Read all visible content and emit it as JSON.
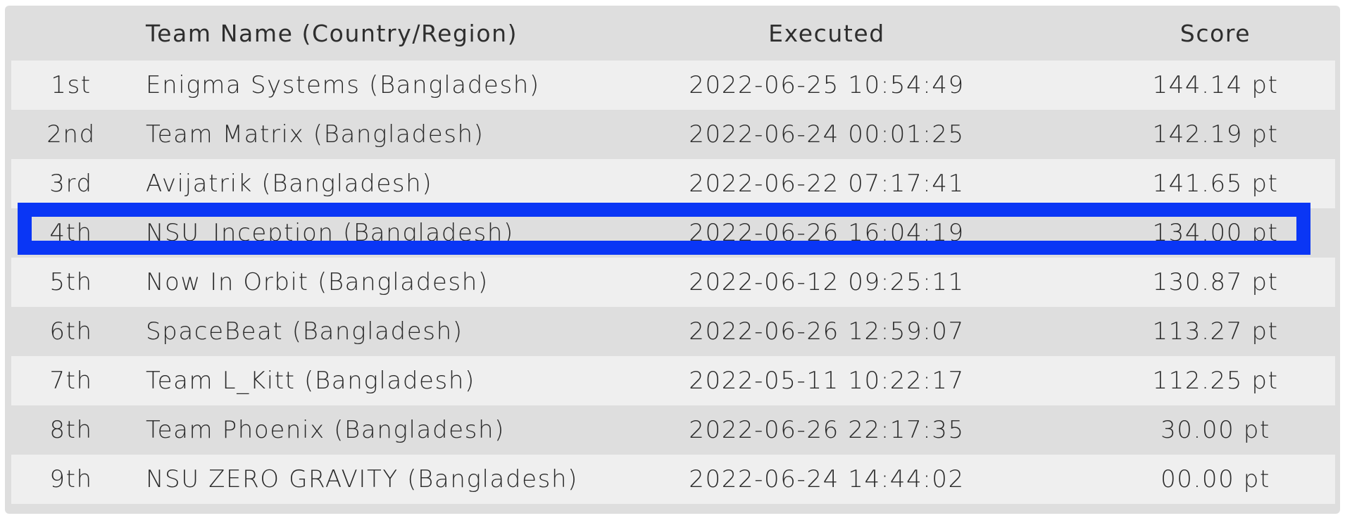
{
  "header": {
    "rank": "",
    "team": "Team Name (Country/Region)",
    "executed": "Executed",
    "score": "Score"
  },
  "rows": [
    {
      "rank": "1st",
      "team": "Enigma Systems (Bangladesh)",
      "executed": "2022-06-25 10:54:49",
      "score": "144.14 pt"
    },
    {
      "rank": "2nd",
      "team": "Team Matrix (Bangladesh)",
      "executed": "2022-06-24 00:01:25",
      "score": "142.19 pt"
    },
    {
      "rank": "3rd",
      "team": "Avijatrik (Bangladesh)",
      "executed": "2022-06-22 07:17:41",
      "score": "141.65 pt"
    },
    {
      "rank": "4th",
      "team": "NSU_Inception (Bangladesh)",
      "executed": "2022-06-26 16:04:19",
      "score": "134.00 pt"
    },
    {
      "rank": "5th",
      "team": "Now In Orbit (Bangladesh)",
      "executed": "2022-06-12 09:25:11",
      "score": "130.87 pt"
    },
    {
      "rank": "6th",
      "team": "SpaceBeat (Bangladesh)",
      "executed": "2022-06-26 12:59:07",
      "score": "113.27 pt"
    },
    {
      "rank": "7th",
      "team": "Team L_Kitt (Bangladesh)",
      "executed": "2022-05-11 10:22:17",
      "score": "112.25 pt"
    },
    {
      "rank": "8th",
      "team": "Team Phoenix (Bangladesh)",
      "executed": "2022-06-26 22:17:35",
      "score": "30.00 pt"
    },
    {
      "rank": "9th",
      "team": "NSU ZERO GRAVITY (Bangladesh)",
      "executed": "2022-06-24 14:44:02",
      "score": "00.00 pt"
    }
  ],
  "highlight": {
    "row_index": 3,
    "color": "#0a36f5"
  },
  "colors": {
    "row_light": "#efefef",
    "row_dark": "#dedede",
    "text": "#2a2a2a"
  }
}
